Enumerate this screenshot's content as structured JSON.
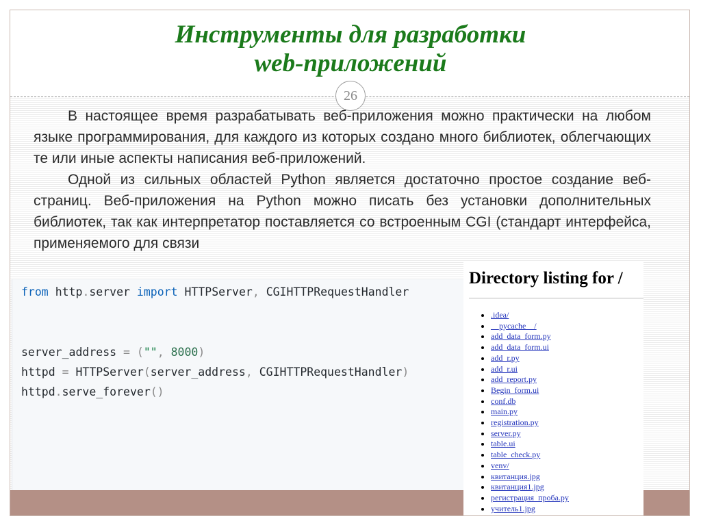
{
  "slide": {
    "title_line1": "Инструменты для разработки",
    "title_line2": "web-приложений",
    "page_number": "26"
  },
  "body": {
    "paragraph1": "В настоящее время разрабатывать веб-приложения можно практически на любом языке программирования, для каждого из которых создано много библиотек, облегчающих те или иные аспекты написания веб-приложений.",
    "paragraph2": "Одной из сильных областей Python является достаточно простое создание веб-страниц. Веб-приложения на Python можно писать без установки дополнительных библиотек, так как интерпретатор поставляется со встроенным CGI (стандарт интерфейса, применяемого для связи"
  },
  "code": {
    "line1": {
      "kw_from": "from",
      "module_http": "http",
      "dot": ".",
      "module_server": "server",
      "kw_import": "import",
      "names": "HTTPServer",
      "comma": ",",
      "names2": "CGIHTTPRequestHandler"
    },
    "line2": {
      "var": "server_address",
      "eq": "=",
      "open": "(",
      "str": "\"\"",
      "comma": ",",
      "num": "8000",
      "close": ")"
    },
    "line3": {
      "var": "httpd",
      "eq": "=",
      "cls": "HTTPServer",
      "open": "(",
      "arg1": "server_address",
      "comma": ",",
      "arg2": "CGIHTTPRequestHandler",
      "close": ")"
    },
    "line4": {
      "var": "httpd",
      "dot": ".",
      "method": "serve_forever",
      "parens": "()"
    }
  },
  "directory": {
    "title": "Directory listing for /",
    "items": [
      ".idea/",
      "__pycache__/",
      "add_data_form.py",
      "add_data_form.ui",
      "add_r.py",
      "add_r.ui",
      "add_report.py",
      "Begin_form.ui",
      "conf.db",
      "main.py",
      "registration.py",
      "server.py",
      "table.ui",
      "table_check.py",
      "venv/",
      "квитанция.jpg",
      "квитанция1.jpg",
      "регистрация_проба.py",
      "учитель1.jpg"
    ]
  },
  "colors": {
    "title_green": "#1b7a1b",
    "bottom_bar": "#b49086",
    "link_blue": "#2233bb"
  }
}
